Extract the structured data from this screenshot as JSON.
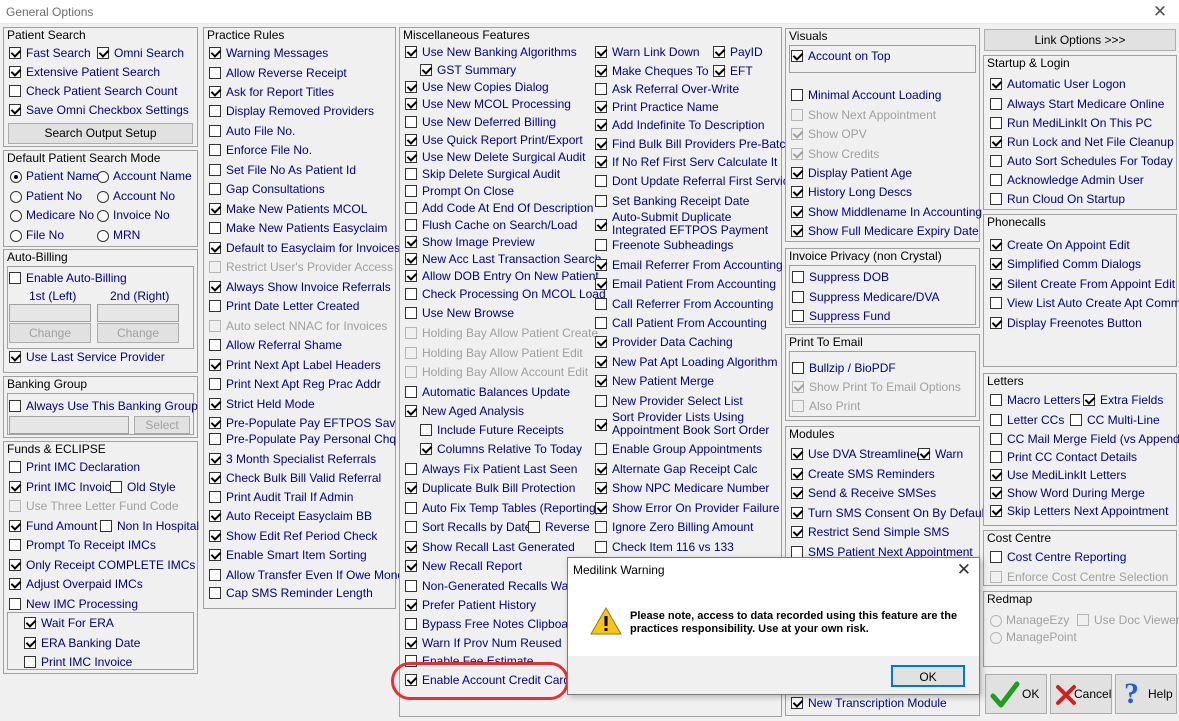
{
  "window": {
    "title": "General Options"
  },
  "patient_search": {
    "header": "Patient Search",
    "items": [
      {
        "label": "Fast Search",
        "checked": true
      },
      {
        "label": "Omni Search",
        "checked": true
      },
      {
        "label": "Extensive Patient Search",
        "checked": true
      },
      {
        "label": "Check Patient Search Count",
        "checked": false
      },
      {
        "label": "Save Omni Checkbox Settings",
        "checked": true
      }
    ],
    "button": "Search Output Setup"
  },
  "default_mode": {
    "header": "Default Patient Search Mode",
    "options": [
      {
        "label": "Patient Name",
        "selected": true
      },
      {
        "label": "Account Name",
        "selected": false
      },
      {
        "label": "Patient No",
        "selected": false
      },
      {
        "label": "Account No",
        "selected": false
      },
      {
        "label": "Medicare No",
        "selected": false
      },
      {
        "label": "Invoice No",
        "selected": false
      },
      {
        "label": "File No",
        "selected": false
      },
      {
        "label": "MRN",
        "selected": false
      }
    ]
  },
  "auto_billing": {
    "header": "Auto-Billing",
    "enable": "Enable Auto-Billing",
    "first": "1st (Left)",
    "second": "2nd (Right)",
    "change": "Change",
    "last_provider": "Use Last Service Provider"
  },
  "banking_group": {
    "header": "Banking Group",
    "always": "Always Use This Banking Group",
    "select": "Select"
  },
  "funds": {
    "header": "Funds & ECLIPSE",
    "items": [
      {
        "label": "Print IMC Declaration",
        "checked": false
      },
      {
        "label": "Print IMC Invoice",
        "checked": true
      },
      {
        "label": "Old Style",
        "checked": false
      },
      {
        "label": "Use Three Letter Fund Code",
        "checked": false,
        "disabled": true
      },
      {
        "label": "Fund Amount",
        "checked": true
      },
      {
        "label": "Non In Hospital",
        "checked": false
      },
      {
        "label": "Prompt To Receipt IMCs",
        "checked": false
      },
      {
        "label": "Only Receipt COMPLETE IMCs",
        "checked": true
      },
      {
        "label": "Adjust Overpaid IMCs",
        "checked": true
      },
      {
        "label": "New IMC Processing",
        "checked": false
      },
      {
        "label": "Wait For ERA",
        "checked": true
      },
      {
        "label": "ERA Banking Date",
        "checked": true
      },
      {
        "label": "Print IMC Invoice",
        "checked": false
      }
    ]
  },
  "practice_rules": {
    "header": "Practice Rules",
    "items": [
      {
        "label": "Warning Messages",
        "checked": true
      },
      {
        "label": "Allow Reverse Receipt",
        "checked": false
      },
      {
        "label": "Ask for Report Titles",
        "checked": true
      },
      {
        "label": "Display Removed Providers",
        "checked": false
      },
      {
        "label": "Auto File No.",
        "checked": false
      },
      {
        "label": "Enforce File No.",
        "checked": false
      },
      {
        "label": "Set File No As Patient Id",
        "checked": false
      },
      {
        "label": "Gap Consultations",
        "checked": false
      },
      {
        "label": "Make New Patients MCOL",
        "checked": true
      },
      {
        "label": "Make New Patients Easyclaim",
        "checked": false
      },
      {
        "label": "Default to Easyclaim for Invoices",
        "checked": true
      },
      {
        "label": "Restrict User's Provider Access",
        "checked": false,
        "disabled": true
      },
      {
        "label": "Always Show Invoice Referrals",
        "checked": true
      },
      {
        "label": "Print Date Letter Created",
        "checked": false
      },
      {
        "label": "Auto select NNAC for Invoices",
        "checked": false,
        "disabled": true
      },
      {
        "label": "Allow Referral Shame",
        "checked": false
      },
      {
        "label": "Print Next Apt Label Headers",
        "checked": true
      },
      {
        "label": "Print Next Apt Reg Prac Addr",
        "checked": false
      },
      {
        "label": "Strict Held Mode",
        "checked": true
      },
      {
        "label": "Pre-Populate Pay EFTPOS Sav",
        "checked": true
      },
      {
        "label": "Pre-Populate Pay Personal Chq",
        "checked": false
      },
      {
        "label": "3 Month Specialist Referrals",
        "checked": true
      },
      {
        "label": "Check Bulk Bill Valid Referral",
        "checked": true
      },
      {
        "label": "Print Audit Trail If Admin",
        "checked": false
      },
      {
        "label": "Auto Receipt Easyclaim BB",
        "checked": true
      },
      {
        "label": "Show Edit Ref Period Check",
        "checked": true
      },
      {
        "label": "Enable Smart Item Sorting",
        "checked": true
      },
      {
        "label": "Allow Transfer Even If Owe Money",
        "checked": false
      },
      {
        "label": "Cap SMS Reminder Length",
        "checked": false
      }
    ]
  },
  "misc": {
    "header": "Miscellaneous Features",
    "col1": [
      {
        "label": "Use New Banking Algorithms",
        "checked": true
      },
      {
        "label": "GST Summary",
        "checked": true
      },
      {
        "label": "Use New Copies Dialog",
        "checked": true
      },
      {
        "label": "Use New MCOL Processing",
        "checked": true
      },
      {
        "label": "Use New Deferred Billing",
        "checked": false
      },
      {
        "label": "Use Quick Report Print/Export",
        "checked": true
      },
      {
        "label": "Use New Delete Surgical Audit",
        "checked": true
      },
      {
        "label": "Skip Delete Surgical Audit",
        "checked": false
      },
      {
        "label": "Prompt On Close",
        "checked": false
      },
      {
        "label": "Add Code At End Of Description",
        "checked": false
      },
      {
        "label": "Flush Cache on Search/Load",
        "checked": false
      },
      {
        "label": "Show Image Preview",
        "checked": true
      },
      {
        "label": "New Acc Last Transaction Search",
        "checked": true
      },
      {
        "label": "Allow DOB Entry On New Patient",
        "checked": true
      },
      {
        "label": "Check Processing On MCOL Load",
        "checked": false
      },
      {
        "label": "Use New Browse",
        "checked": false
      },
      {
        "label": "Holding Bay Allow Patient Create",
        "checked": false,
        "disabled": true
      },
      {
        "label": "Holding Bay Allow Patient Edit",
        "checked": false,
        "disabled": true
      },
      {
        "label": "Holding Bay Allow Account Edit",
        "checked": false,
        "disabled": true
      },
      {
        "label": "Automatic Balances Update",
        "checked": false
      },
      {
        "label": "New Aged Analysis",
        "checked": true
      },
      {
        "label": "Include Future Receipts",
        "checked": false
      },
      {
        "label": "Columns Relative To Today",
        "checked": true
      },
      {
        "label": "Always Fix Patient Last Seen",
        "checked": false
      },
      {
        "label": "Duplicate Bulk Bill Protection",
        "checked": true
      },
      {
        "label": "Auto Fix Temp Tables (Reporting)",
        "checked": false
      },
      {
        "label": "Sort Recalls by Date",
        "checked": false
      },
      {
        "label": "Reverse",
        "checked": false
      },
      {
        "label": "Show Recall Last Generated",
        "checked": true
      },
      {
        "label": "New Recall Report",
        "checked": true
      },
      {
        "label": "Non-Generated Recalls Warning",
        "checked": false
      },
      {
        "label": "Prefer Patient History",
        "checked": true
      },
      {
        "label": "Bypass Free Notes Clipboard",
        "checked": false
      },
      {
        "label": "Warn If Prov Num Reused",
        "checked": true
      },
      {
        "label": "Enable Fee Estimate",
        "checked": false
      },
      {
        "label": "Enable Account Credit Card",
        "checked": true
      }
    ],
    "col2": [
      {
        "label": "Warn Link Down",
        "checked": true
      },
      {
        "label": "PayID",
        "checked": true
      },
      {
        "label": "Make Cheques To",
        "checked": true
      },
      {
        "label": "EFT",
        "checked": true
      },
      {
        "label": "Ask Referral Over-Write",
        "checked": false
      },
      {
        "label": "Print Practice Name",
        "checked": true
      },
      {
        "label": "Add Indefinite To Description",
        "checked": true
      },
      {
        "label": "Find Bulk Bill Providers Pre-Batch",
        "checked": true
      },
      {
        "label": "If No Ref First Serv Calculate It",
        "checked": true
      },
      {
        "label": "Dont Update Referral First Service",
        "checked": false
      },
      {
        "label": "Set Banking Receipt Date",
        "checked": false
      },
      {
        "label": "Auto-Submit Duplicate Integrated EFTPOS Payment",
        "checked": true
      },
      {
        "label": "Freenote Subheadings",
        "checked": false
      },
      {
        "label": "Email Referrer From Accounting",
        "checked": true
      },
      {
        "label": "Email Patient From Accounting",
        "checked": true
      },
      {
        "label": "Call Referrer From Accounting",
        "checked": false
      },
      {
        "label": "Call Patient From Accounting",
        "checked": false
      },
      {
        "label": "Provider Data Caching",
        "checked": true
      },
      {
        "label": "New Pat Apt Loading Algorithm",
        "checked": true
      },
      {
        "label": "New Patient Merge",
        "checked": true
      },
      {
        "label": "New Provider Select List",
        "checked": false
      },
      {
        "label": "Sort Provider Lists Using Appointment Book Sort Order",
        "checked": true
      },
      {
        "label": "Enable Group Appointments",
        "checked": false
      },
      {
        "label": "Alternate Gap Receipt Calc",
        "checked": true
      },
      {
        "label": "Show NPC Medicare Number",
        "checked": true
      },
      {
        "label": "Show Error On Provider Failure",
        "checked": true
      },
      {
        "label": "Ignore Zero Billing Amount",
        "checked": false
      },
      {
        "label": "Check Item 116 vs 133",
        "checked": false
      }
    ]
  },
  "visuals": {
    "header": "Visuals",
    "items": [
      {
        "label": "Account on Top",
        "checked": true
      },
      {
        "label": "Minimal Account Loading",
        "checked": false
      },
      {
        "label": "Show Next Appointment",
        "checked": false,
        "disabled": true
      },
      {
        "label": "Show OPV",
        "checked": true,
        "disabled": true
      },
      {
        "label": "Show Credits",
        "checked": true,
        "disabled": true
      },
      {
        "label": "Display Patient Age",
        "checked": true
      },
      {
        "label": "History Long Descs",
        "checked": true
      },
      {
        "label": "Show Middlename In Accounting",
        "checked": true
      },
      {
        "label": "Show Full Medicare Expiry Date",
        "checked": true
      }
    ]
  },
  "invoice_privacy": {
    "header": "Invoice Privacy (non Crystal)",
    "items": [
      {
        "label": "Suppress DOB",
        "checked": false
      },
      {
        "label": "Suppress Medicare/DVA",
        "checked": false
      },
      {
        "label": "Suppress Fund",
        "checked": false
      }
    ]
  },
  "print_email": {
    "header": "Print To Email",
    "items": [
      {
        "label": "Bullzip / BioPDF",
        "checked": false
      },
      {
        "label": "Show Print To Email Options",
        "checked": true,
        "disabled": true
      },
      {
        "label": "Also Print",
        "checked": false,
        "disabled": true
      }
    ]
  },
  "modules": {
    "header": "Modules",
    "items": [
      {
        "label": "Use DVA Streamlined",
        "checked": true
      },
      {
        "label": "Warn",
        "checked": true
      },
      {
        "label": "Create SMS Reminders",
        "checked": true
      },
      {
        "label": "Send & Receive SMSes",
        "checked": true
      },
      {
        "label": "Turn SMS Consent On By Default",
        "checked": true
      },
      {
        "label": "Restrict Send Simple SMS",
        "checked": true
      },
      {
        "label": "SMS Patient Next Appointment",
        "checked": false
      },
      {
        "label": "New Transcription Module",
        "checked": true
      }
    ]
  },
  "link_options": "Link Options >>>",
  "startup": {
    "header": "Startup & Login",
    "items": [
      {
        "label": "Automatic User Logon",
        "checked": true
      },
      {
        "label": "Always Start Medicare Online",
        "checked": false
      },
      {
        "label": "Run MediLinkIt On This PC",
        "checked": false
      },
      {
        "label": "Run Lock and Net File Cleanup",
        "checked": true
      },
      {
        "label": "Auto Sort Schedules For Today",
        "checked": false
      },
      {
        "label": "Acknowledge Admin User",
        "checked": false
      },
      {
        "label": "Run Cloud On Startup",
        "checked": false
      }
    ]
  },
  "phonecalls": {
    "header": "Phonecalls",
    "items": [
      {
        "label": "Create On Appoint Edit",
        "checked": true
      },
      {
        "label": "Simplified Comm Dialogs",
        "checked": true
      },
      {
        "label": "Silent Create From Appoint Edit",
        "checked": true
      },
      {
        "label": "View List Auto Create Apt Comms",
        "checked": false
      },
      {
        "label": "Display Freenotes Button",
        "checked": true
      }
    ]
  },
  "letters": {
    "header": "Letters",
    "items": [
      {
        "label": "Macro Letters",
        "checked": false
      },
      {
        "label": "Extra Fields",
        "checked": true
      },
      {
        "label": "Letter CCs",
        "checked": false
      },
      {
        "label": "CC Multi-Line",
        "checked": false
      },
      {
        "label": "CC Mail Merge Field (vs Append)",
        "checked": false
      },
      {
        "label": "Print CC Contact Details",
        "checked": false
      },
      {
        "label": "Use MediLinkIt Letters",
        "checked": true
      },
      {
        "label": "Show Word During Merge",
        "checked": true
      },
      {
        "label": "Skip Letters Next Appointment",
        "checked": true
      }
    ]
  },
  "cost_centre": {
    "header": "Cost Centre",
    "items": [
      {
        "label": "Cost Centre Reporting",
        "checked": false
      },
      {
        "label": "Enforce Cost Centre Selection",
        "checked": false,
        "disabled": true
      }
    ]
  },
  "redmap": {
    "header": "Redmap",
    "items": [
      {
        "label": "ManageEzy",
        "disabled": true
      },
      {
        "label": "Use Doc Viewer",
        "disabled": true
      },
      {
        "label": "ManagePoint",
        "disabled": true
      }
    ]
  },
  "buttons": {
    "ok": "OK",
    "cancel": "Cancel",
    "help": "Help"
  },
  "dialog": {
    "title": "Medilink Warning",
    "message": "Please note, access to data recorded using this feature are the practices responsibility. Use at your own risk.",
    "ok": "OK"
  },
  "colors": {
    "label_text": "#00008b",
    "disabled_text": "#a0a0a0",
    "highlight": "#e53030",
    "ok_green": "#1e9e1e",
    "cancel_red": "#d21f1f",
    "help_blue": "#1f5fd2"
  }
}
